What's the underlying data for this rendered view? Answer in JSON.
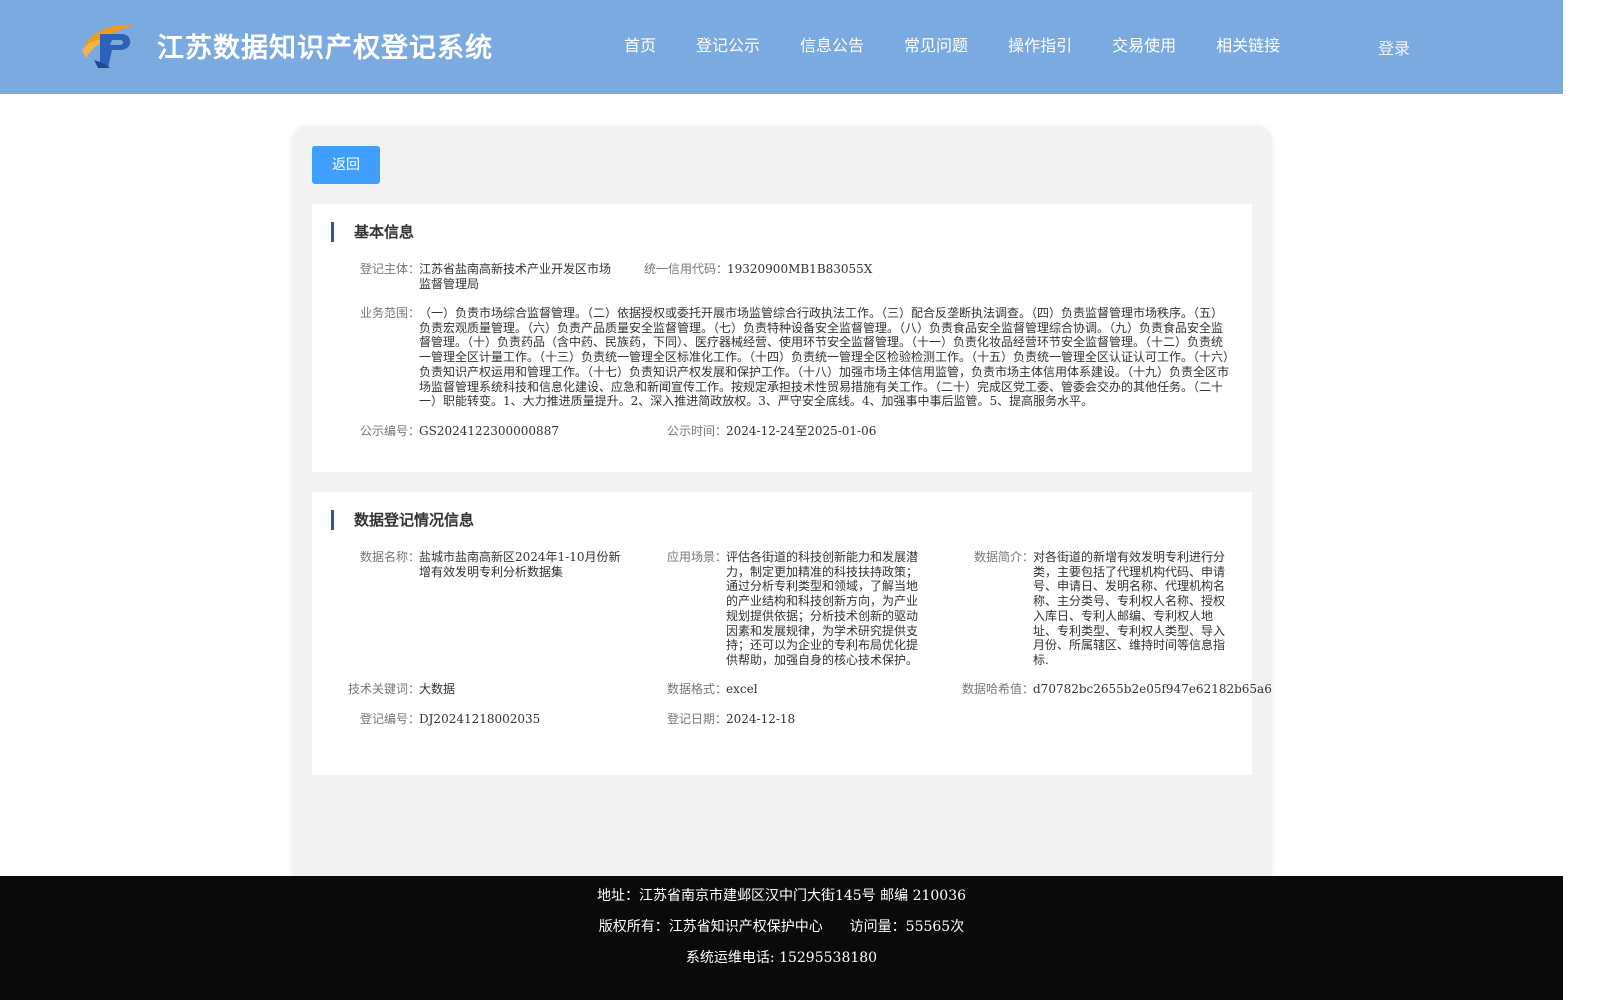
{
  "header": {
    "title": "江苏数据知识产权登记系统",
    "logo_icon": "ip-logo-icon",
    "nav": [
      "首页",
      "登记公示",
      "信息公告",
      "常见问题",
      "操作指引",
      "交易使用",
      "相关链接"
    ],
    "login": "登录",
    "bg_color": "#7aaadf"
  },
  "main": {
    "back_label": "返回",
    "basic": {
      "title": "基本信息",
      "subject_label": "登记主体：",
      "subject_value": "江苏省盐南高新技术产业开发区市场监督管理局",
      "credit_label": "统一信用代码：",
      "credit_value": "19320900MB1B83055X",
      "scope_label": "业务范围：",
      "scope_value": "（一）负责市场综合监督管理。（二）依据授权或委托开展市场监管综合行政执法工作。（三）配合反垄断执法调查。（四）负责监督管理市场秩序。（五）负责宏观质量管理。（六）负责产品质量安全监督管理。（七）负责特种设备安全监督管理。（八）负责食品安全监督管理综合协调。（九）负责食品安全监督管理。（十）负责药品（含中药、民族药，下同）、医疗器械经营、使用环节安全监督管理。（十一）负责化妆品经营环节安全监督管理。（十二）负责统一管理全区计量工作。（十三）负责统一管理全区标准化工作。（十四）负责统一管理全区检验检测工作。（十五）负责统一管理全区认证认可工作。（十六）负责知识产权运用和管理工作。（十七）负责知识产权发展和保护工作。（十八）加强市场主体信用监管，负责市场主体信用体系建设。（十九）负责全区市场监督管理系统科技和信息化建设、应急和新闻宣传工作。按规定承担技术性贸易措施有关工作。（二十）完成区党工委、管委会交办的其他任务。（二十一）职能转变。1、大力推进质量提升。2、深入推进简政放权。3、严守安全底线。4、加强事中事后监管。5、提高服务水平。",
      "pub_no_label": "公示编号：",
      "pub_no_value": "GS2024122300000887",
      "pub_time_label": "公示时间：",
      "pub_time_value": "2024-12-24至2025-01-06"
    },
    "data": {
      "title": "数据登记情况信息",
      "name_label": "数据名称：",
      "name_value": "盐城市盐南高新区2024年1-10月份新增有效发明专利分析数据集",
      "scene_label": "应用场景：",
      "scene_value": "评估各街道的科技创新能力和发展潜力，制定更加精准的科技扶持政策；通过分析专利类型和领域，了解当地的产业结构和科技创新方向，为产业规划提供依据；分析技术创新的驱动因素和发展规律，为学术研究提供支持；还可以为企业的专利布局优化提供帮助，加强自身的核心技术保护。",
      "intro_label": "数据简介：",
      "intro_value": "对各街道的新增有效发明专利进行分类，主要包括了代理机构代码、申请号、申请日、发明名称、代理机构名称、主分类号、专利权人名称、授权入库日、专利人邮编、专利权人地址、专利类型、专利权人类型、导入月份、所属辖区、维持时间等信息指标.",
      "keyword_label": "技术关键词：",
      "keyword_value": "大数据",
      "format_label": "数据格式：",
      "format_value": "excel",
      "hash_label": "数据哈希值：",
      "hash_value": "d70782bc2655b2e05f947e62182b65a6",
      "reg_no_label": "登记编号：",
      "reg_no_value": "DJ20241218002035",
      "reg_date_label": "登记日期：",
      "reg_date_value": "2024-12-18"
    }
  },
  "footer": {
    "address": "地址：江苏省南京市建邺区汉中门大街145号 邮编 210036",
    "copyright": "版权所有：江苏省知识产权保护中心",
    "visits": "访问量：55565次",
    "phone": "系统运维电话: 15295538180"
  }
}
